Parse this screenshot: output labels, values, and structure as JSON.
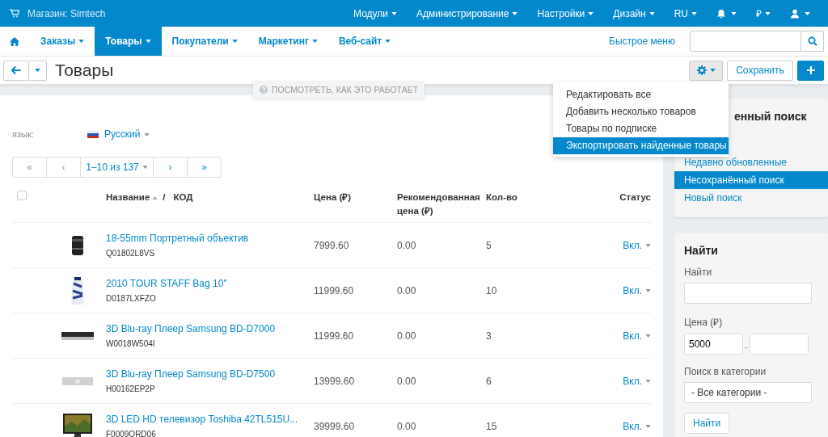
{
  "top_bar": {
    "store": "Магазин: Simtech",
    "menus": [
      "Модули",
      "Администрирование",
      "Настройки",
      "Дизайн",
      "RU"
    ],
    "currency": "₽"
  },
  "nav": {
    "tabs": [
      {
        "label": "Заказы",
        "selected": false
      },
      {
        "label": "Товары",
        "selected": true
      },
      {
        "label": "Покупатели",
        "selected": false
      },
      {
        "label": "Маркетинг",
        "selected": false
      },
      {
        "label": "Веб-сайт",
        "selected": false
      }
    ],
    "quick_menu": "Быстрое меню"
  },
  "page": {
    "title": "Товары",
    "save": "Сохранить",
    "help": "ПОСМОТРЕТЬ, КАК ЭТО РАБОТАЕТ"
  },
  "gear_menu": [
    {
      "label": "Редактировать все",
      "selected": false
    },
    {
      "label": "Добавить несколько товаров",
      "selected": false
    },
    {
      "label": "Товары по подписке",
      "selected": false
    },
    {
      "label": "Экспортировать найденные товары",
      "selected": true
    }
  ],
  "language": {
    "label": "язык:",
    "value": "Русский"
  },
  "pagination": [
    "«",
    "‹",
    "1–10 из 137",
    "›",
    "»"
  ],
  "table": {
    "select_all": {
      "checked": false
    },
    "columns": {
      "name": "Название",
      "separator": "/",
      "code": "КОД",
      "price": "Цена (₽)",
      "rec_price": "Рекомендованная цена (₽)",
      "qty": "Кол-во",
      "status": "Статус"
    },
    "rows": [
      {
        "name": "18-55mm Портретный объектив",
        "code": "Q01802L8VS",
        "price": "7999.60",
        "rec_price": "0.00",
        "qty": "5",
        "status": "Вкл."
      },
      {
        "name": "2010 TOUR STAFF Bag 10\"",
        "code": "D0187LXFZO",
        "price": "11999.60",
        "rec_price": "0.00",
        "qty": "10",
        "status": "Вкл."
      },
      {
        "name": "3D Blu-ray Плеер Samsung BD-D7000",
        "code": "W0018W504I",
        "price": "11999.60",
        "rec_price": "0.00",
        "qty": "3",
        "status": "Вкл."
      },
      {
        "name": "3D Blu-ray Плеер  Samsung BD-D7500",
        "code": "H00162EP2P",
        "price": "13999.60",
        "rec_price": "0.00",
        "qty": "6",
        "status": "Вкл."
      },
      {
        "name": "3D LED HD телевизор Toshiba 42TL515U...",
        "code": "F0009ORD06",
        "price": "39999.60",
        "rec_price": "0.00",
        "qty": "15",
        "status": "Вкл."
      }
    ]
  },
  "saved_search": {
    "title": "енный поиск",
    "items": [
      {
        "label": "Недавно обновленные",
        "selected": false
      },
      {
        "label": "Несохранённый поиск",
        "selected": true
      },
      {
        "label": "Новый поиск",
        "selected": false
      }
    ]
  },
  "search_form": {
    "title": "Найти",
    "find_label": "Найти",
    "price_label": "Цена (₽)",
    "price_from": "5000",
    "price_sep": "-",
    "category_label": "Поиск в категории",
    "category": "- Все категории -",
    "button": "Найти"
  }
}
